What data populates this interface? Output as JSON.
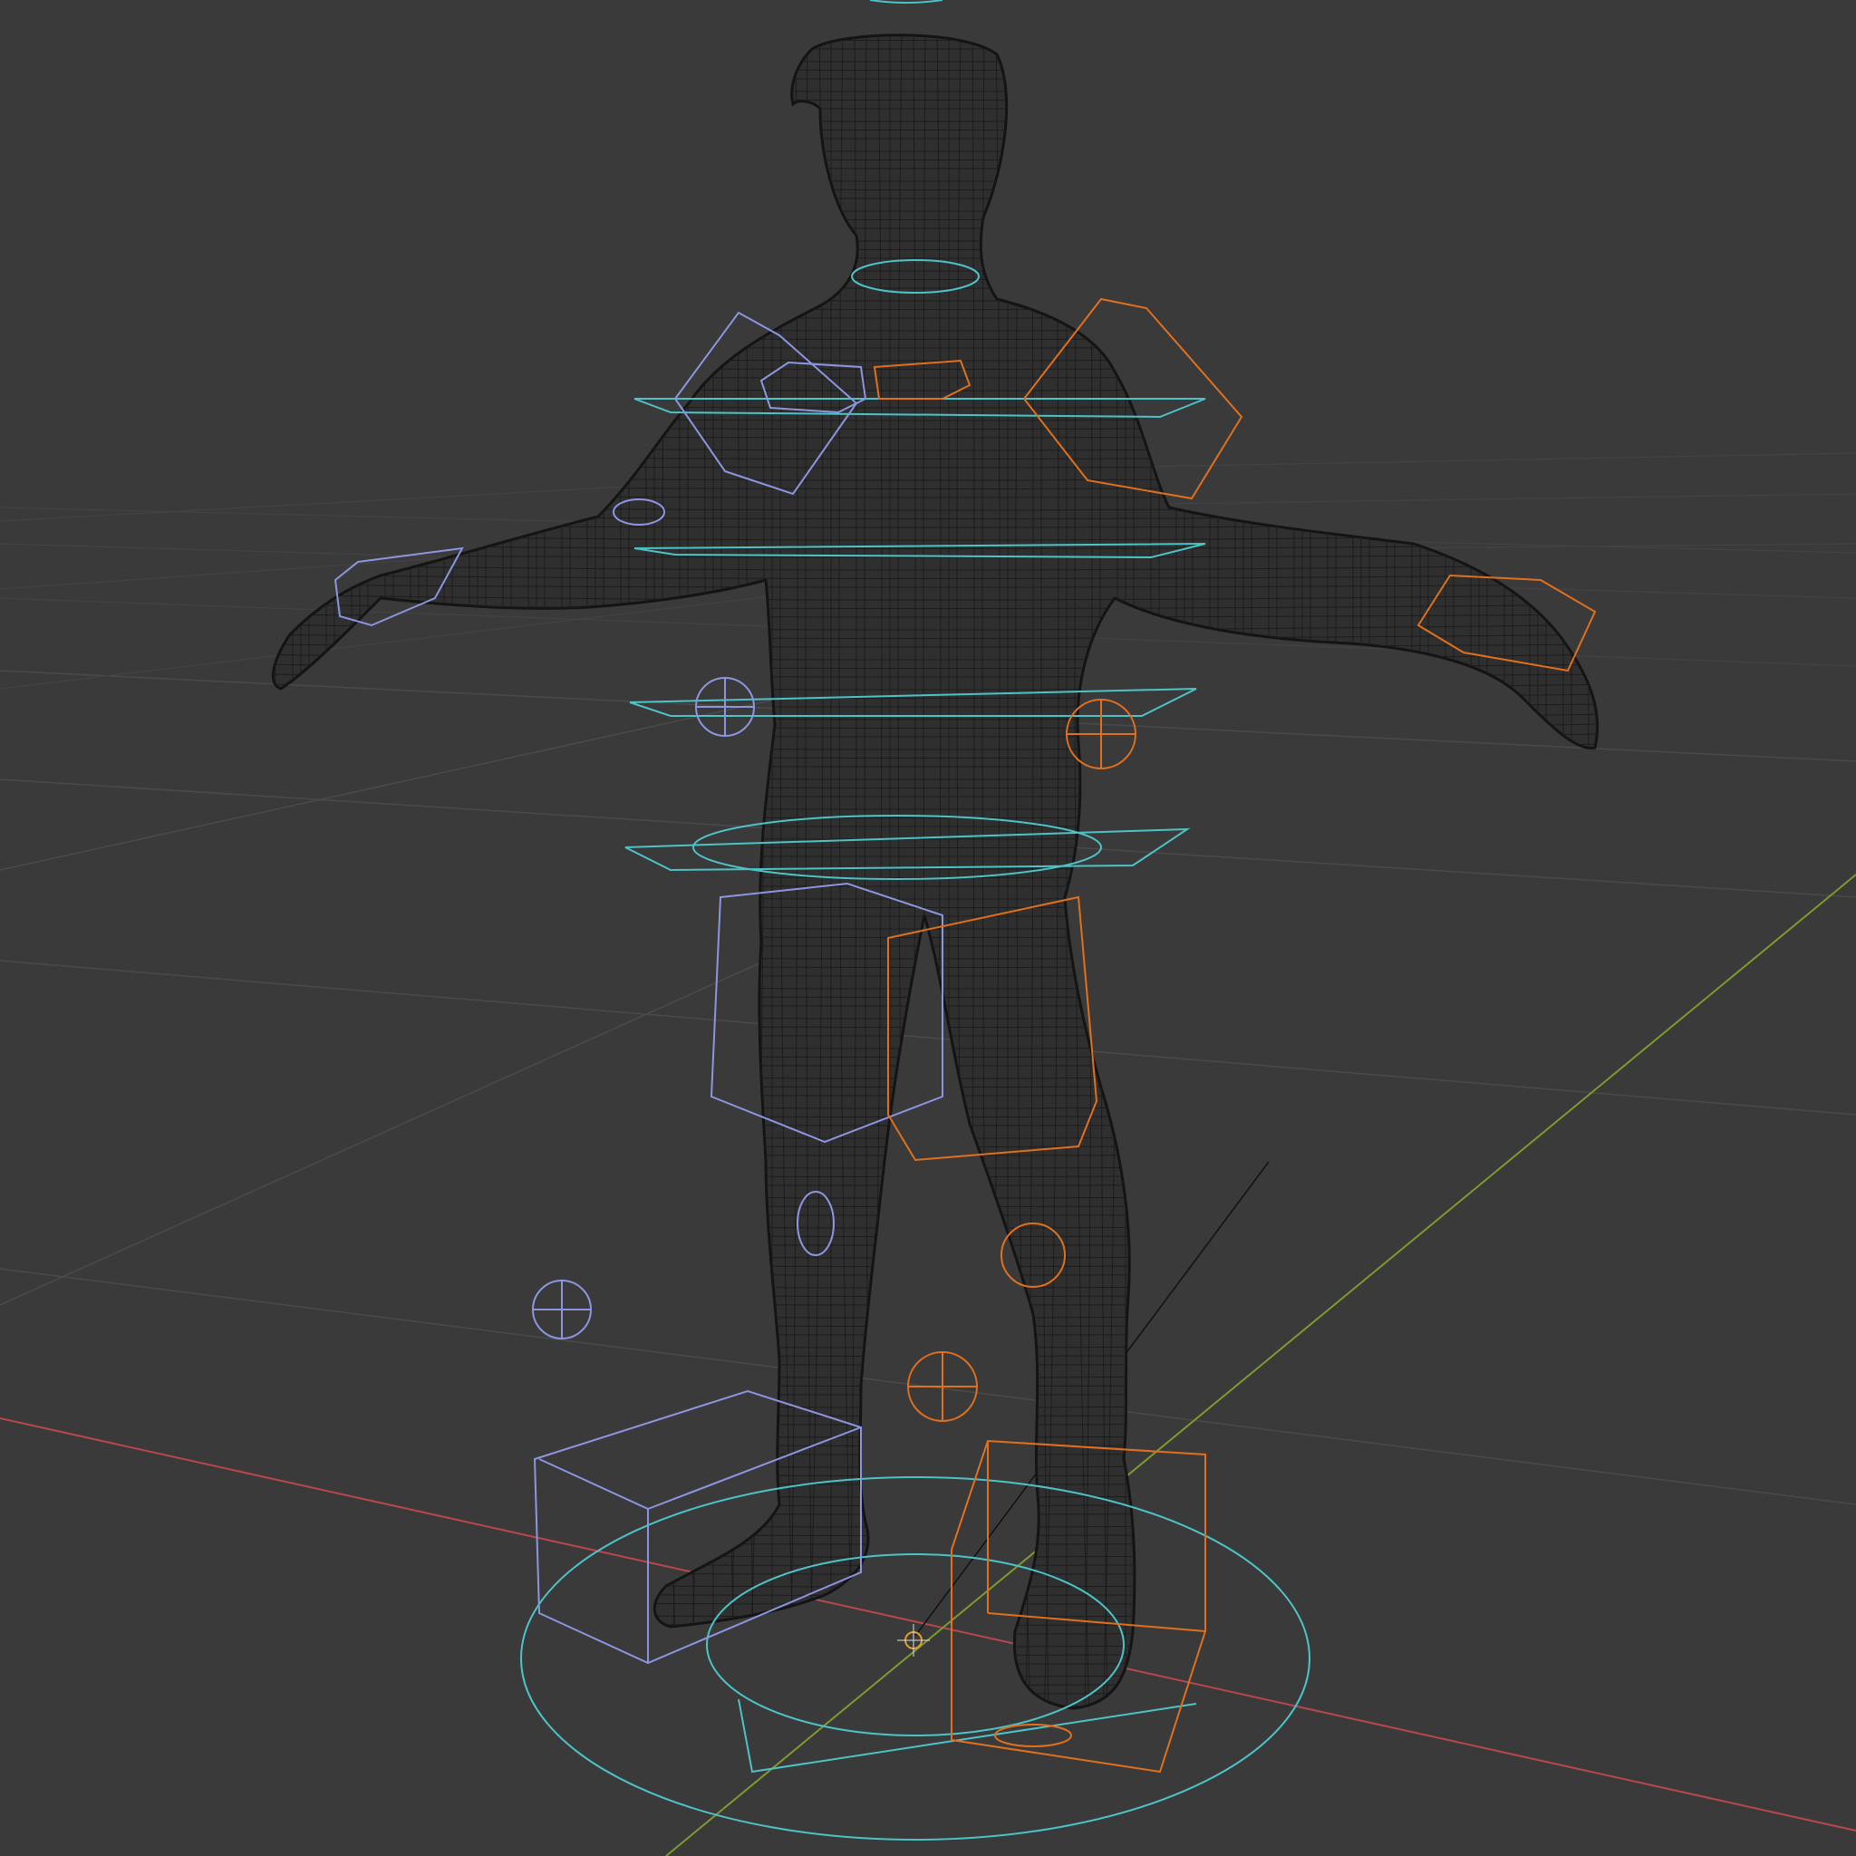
{
  "viewport": {
    "mode": "wireframe",
    "background": "#3a3a3a",
    "grid_color": "#4a4a4a",
    "axis_x_color": "#b8474f",
    "axis_y_color": "#7e9a2e",
    "mesh_color": "#151515"
  },
  "rig": {
    "left_side_color": "#8c96e0",
    "right_side_color": "#e0701e",
    "center_color": "#4dc3c8"
  },
  "icons": {
    "origin": "3d-cursor-icon"
  }
}
